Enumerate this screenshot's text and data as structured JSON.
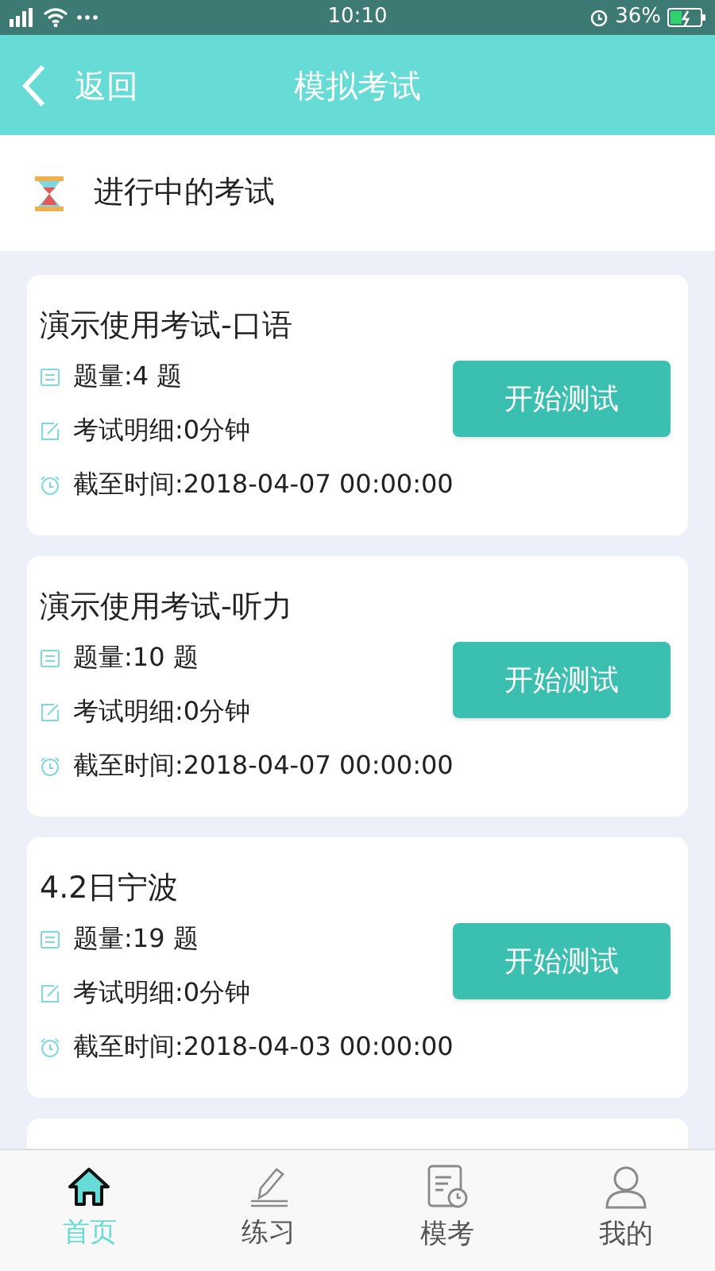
{
  "status_bar": {
    "time": "10:10",
    "battery": "36%"
  },
  "nav_bar": {
    "back": "返回",
    "title": "模拟考试"
  },
  "section": {
    "title": "进行中的考试"
  },
  "exams": [
    {
      "title": "演示使用考试-口语",
      "count": "题量:4 题",
      "detail": "考试明细:0分钟",
      "deadline": "截至时间:2018-04-07 00:00:00",
      "button": "开始测试"
    },
    {
      "title": "演示使用考试-听力",
      "count": "题量:10 题",
      "detail": "考试明细:0分钟",
      "deadline": "截至时间:2018-04-07 00:00:00",
      "button": "开始测试"
    },
    {
      "title": "4.2日宁波",
      "count": "题量:19 题",
      "detail": "考试明细:0分钟",
      "deadline": "截至时间:2018-04-03 00:00:00",
      "button": "开始测试"
    }
  ],
  "tabs": [
    {
      "kind": "home",
      "label": "首页",
      "selected": true
    },
    {
      "kind": "practice",
      "label": "练习",
      "selected": false
    },
    {
      "kind": "mock",
      "label": "模考",
      "selected": false
    },
    {
      "kind": "profile",
      "label": "我的",
      "selected": false
    }
  ]
}
